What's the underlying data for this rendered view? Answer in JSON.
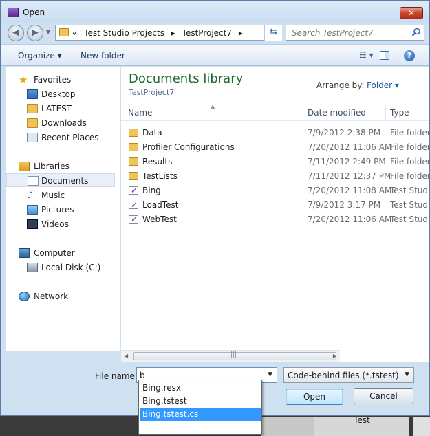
{
  "window": {
    "title": "Open",
    "close_label": "✕"
  },
  "address": {
    "prefix": "«",
    "crumbs": [
      "Test Studio Projects",
      "TestProject7"
    ],
    "separator": "▸"
  },
  "search": {
    "placeholder": "Search TestProject7"
  },
  "toolbar": {
    "organize_label": "Organize ▾",
    "new_folder_label": "New folder",
    "help_label": "?"
  },
  "nav": {
    "favorites": "Favorites",
    "favorite_items": [
      "Desktop",
      "LATEST",
      "Downloads",
      "Recent Places"
    ],
    "libraries": "Libraries",
    "library_items": [
      "Documents",
      "Music",
      "Pictures",
      "Videos"
    ],
    "computer": "Computer",
    "computer_items": [
      "Local Disk (C:)"
    ],
    "network": "Network"
  },
  "content": {
    "title": "Documents library",
    "subtitle": "TestProject7",
    "arrange_label": "Arrange by:",
    "arrange_value": "Folder ▾",
    "columns": {
      "name": "Name",
      "date": "Date modified",
      "type": "Type"
    },
    "rows": [
      {
        "name": "Data",
        "date": "7/9/2012 2:38 PM",
        "type": "File folder",
        "icon": "folder-icon"
      },
      {
        "name": "Profiler Configurations",
        "date": "7/20/2012 11:06 AM",
        "type": "File folder",
        "icon": "folder-icon"
      },
      {
        "name": "Results",
        "date": "7/11/2012 2:49 PM",
        "type": "File folder",
        "icon": "folder-icon"
      },
      {
        "name": "TestLists",
        "date": "7/11/2012 12:37 PM",
        "type": "File folder",
        "icon": "folder-icon"
      },
      {
        "name": "Bing",
        "date": "7/20/2012 11:08 AM",
        "type": "Test Studio",
        "icon": "test-file-icon"
      },
      {
        "name": "LoadTest",
        "date": "7/9/2012 3:17 PM",
        "type": "Test Studio",
        "icon": "test-file-icon"
      },
      {
        "name": "WebTest",
        "date": "7/20/2012 11:06 AM",
        "type": "Test Studio",
        "icon": "test-file-icon"
      }
    ]
  },
  "bottom": {
    "file_name_label": "File name:",
    "file_name_value": "b",
    "filter_value": "Code-behind files (*.tstest)",
    "open_label": "Open",
    "cancel_label": "Cancel"
  },
  "autocomplete": {
    "items": [
      "Bing.resx",
      "Bing.tstest",
      "Bing.tstest.cs"
    ],
    "selected_index": 2
  },
  "background": {
    "behind_label": "Test"
  }
}
